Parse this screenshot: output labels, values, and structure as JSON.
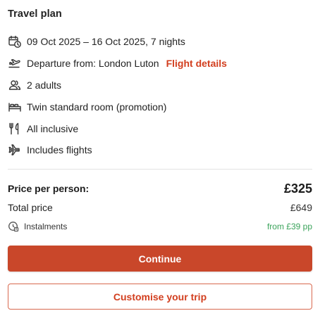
{
  "title": "Travel plan",
  "details": {
    "dates": {
      "icon": "calendar-clock-icon",
      "text": "09 Oct 2025 – 16 Oct 2025, 7 nights"
    },
    "departure": {
      "icon": "plane-departure-icon",
      "text": "Departure from: London Luton",
      "link": "Flight details"
    },
    "guests": {
      "icon": "users-icon",
      "text": "2 adults"
    },
    "room": {
      "icon": "bed-icon",
      "text": "Twin standard room (promotion)"
    },
    "board": {
      "icon": "cutlery-icon",
      "text": "All inclusive"
    },
    "flights": {
      "icon": "plane-icon",
      "text": "Includes flights"
    }
  },
  "pricing": {
    "per_person_label": "Price per person:",
    "per_person_value": "£325",
    "total_label": "Total price",
    "total_value": "£649",
    "instalments_label": "Instalments",
    "instalments_value": "from £39 pp"
  },
  "buttons": {
    "continue": "Continue",
    "customise": "Customise your trip"
  },
  "colors": {
    "accent": "#c9472a",
    "link": "#d23e1e",
    "instalments": "#3aa35a"
  }
}
